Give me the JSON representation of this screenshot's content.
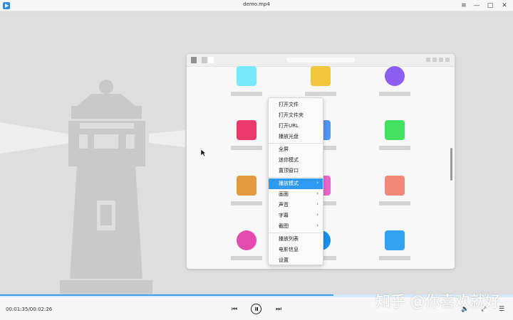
{
  "window": {
    "title": "demo.mp4",
    "menu_icon": "≡",
    "min_icon": "—",
    "max_icon": "□",
    "close_icon": "✕"
  },
  "context_menu": {
    "groups": [
      [
        {
          "label": "打开文件"
        },
        {
          "label": "打开文件夹"
        },
        {
          "label": "打开URL"
        },
        {
          "label": "播放光盘"
        }
      ],
      [
        {
          "label": "全屏"
        },
        {
          "label": "迷你模式"
        },
        {
          "label": "置顶窗口"
        }
      ],
      [
        {
          "label": "播放模式",
          "submenu": true,
          "active": true
        },
        {
          "label": "画面",
          "submenu": true
        },
        {
          "label": "声音",
          "submenu": true
        },
        {
          "label": "字幕",
          "submenu": true
        },
        {
          "label": "截图",
          "submenu": true
        }
      ],
      [
        {
          "label": "播放列表"
        },
        {
          "label": "电影信息"
        },
        {
          "label": "设置"
        }
      ]
    ],
    "submenu_arrow": "›"
  },
  "launcher": {
    "tile_colors": [
      "#7ae8fb",
      "#f2c53a",
      "#8e5ef0",
      "#ea3a6b",
      "#4f96f0",
      "#44e060",
      "#e39a3e",
      "#e966c9",
      "#f28878",
      "#e44aaf",
      "#1d8fe6",
      "#34a2ef"
    ]
  },
  "player": {
    "elapsed_time": "00:01:35/00:02:26",
    "progress": 0.65,
    "prev_icon": "⏮",
    "next_icon": "⏭",
    "volume_icon": "🔈",
    "fullscreen_icon": "⤢",
    "playlist_icon": "☰"
  },
  "watermark": "知乎 @你喜欢就好"
}
